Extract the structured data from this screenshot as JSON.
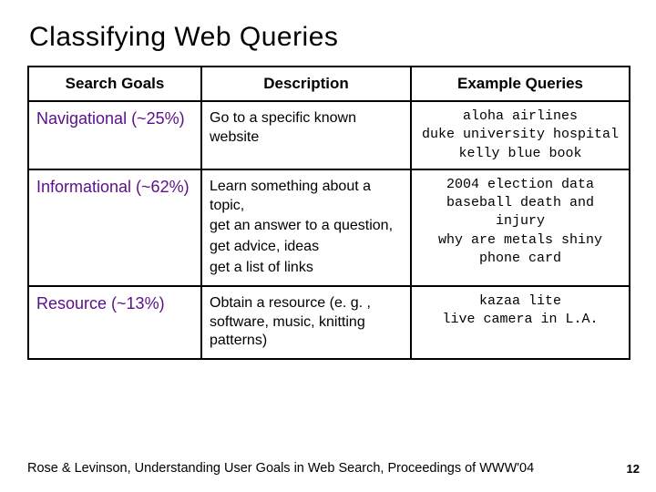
{
  "title": "Classifying Web Queries",
  "headers": {
    "col1": "Search Goals",
    "col2": "Description",
    "col3": "Example Queries"
  },
  "rows": [
    {
      "goal": "Navigational (~25%)",
      "desc": [
        "Go to a specific known website"
      ],
      "examples": [
        "aloha airlines",
        "duke university hospital",
        "kelly blue book"
      ]
    },
    {
      "goal": "Informational (~62%)",
      "desc": [
        "Learn something about a topic,",
        "get an answer to a question,",
        "get advice, ideas",
        "get a list of links"
      ],
      "examples": [
        "2004 election data",
        "baseball death and injury",
        "why are metals shiny",
        "phone card"
      ]
    },
    {
      "goal": "Resource (~13%)",
      "desc": [
        "Obtain a resource (e. g. , software, music, knitting patterns)"
      ],
      "examples": [
        "kazaa lite",
        "live camera in L.A."
      ]
    }
  ],
  "citation": "Rose & Levinson, Understanding User Goals in Web Search, Proceedings of WWW'04",
  "page_number": "12"
}
